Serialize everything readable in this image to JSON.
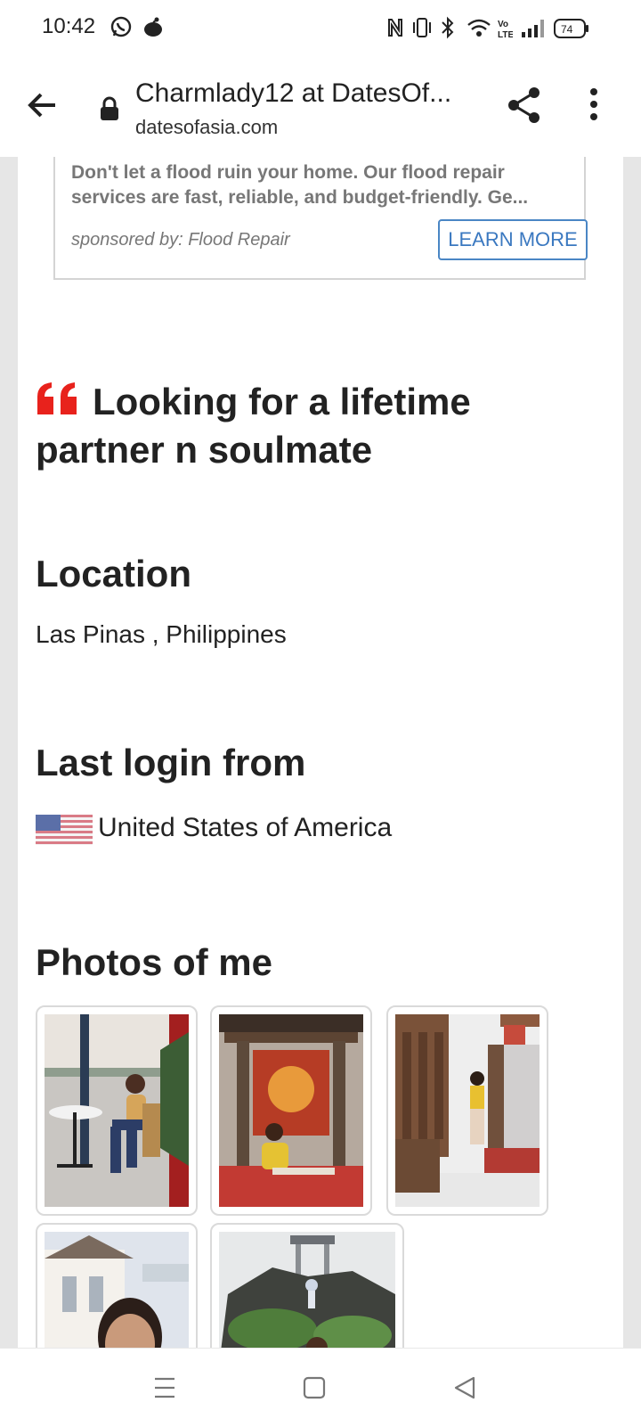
{
  "status_bar": {
    "time": "10:42",
    "left_icons": [
      "whatsapp-icon",
      "notification-icon"
    ],
    "right_icons": [
      "nfc-icon",
      "vibrate-icon",
      "bluetooth-icon",
      "wifi-icon",
      "volte-icon",
      "signal-icon"
    ],
    "volte_label": "Vo\nLTE",
    "battery": "74"
  },
  "browser": {
    "title": "Charmlady12 at DatesOf...",
    "url": "datesofasia.com"
  },
  "ad": {
    "text": "Don't let a flood ruin your home. Our flood repair services are fast, reliable, and budget-friendly. Ge...",
    "sponsor": "sponsored by: Flood Repair",
    "cta": "LEARN MORE",
    "cta_color": "#3a78c0"
  },
  "profile": {
    "headline": "Looking for a lifetime partner n soulmate",
    "quote_color": "#e8221c",
    "location_title": "Location",
    "location": "Las Pinas , Philippines",
    "last_login_title": "Last login from",
    "last_login_country": "United States of America",
    "photos_title": "Photos of me"
  },
  "photos": [
    {
      "name": "photo-1",
      "scene": "woman seated in mall beside christmas tree"
    },
    {
      "name": "photo-2",
      "scene": "woman seated under red pavilion"
    },
    {
      "name": "photo-3",
      "scene": "woman posing beside white wall and wooden door"
    },
    {
      "name": "photo-4",
      "scene": "selfie in front of white building"
    },
    {
      "name": "photo-5",
      "scene": "woman in front of grotto with statues"
    }
  ],
  "nav": {
    "icons": [
      "recent-apps-icon",
      "home-icon",
      "back-triangle-icon"
    ]
  }
}
